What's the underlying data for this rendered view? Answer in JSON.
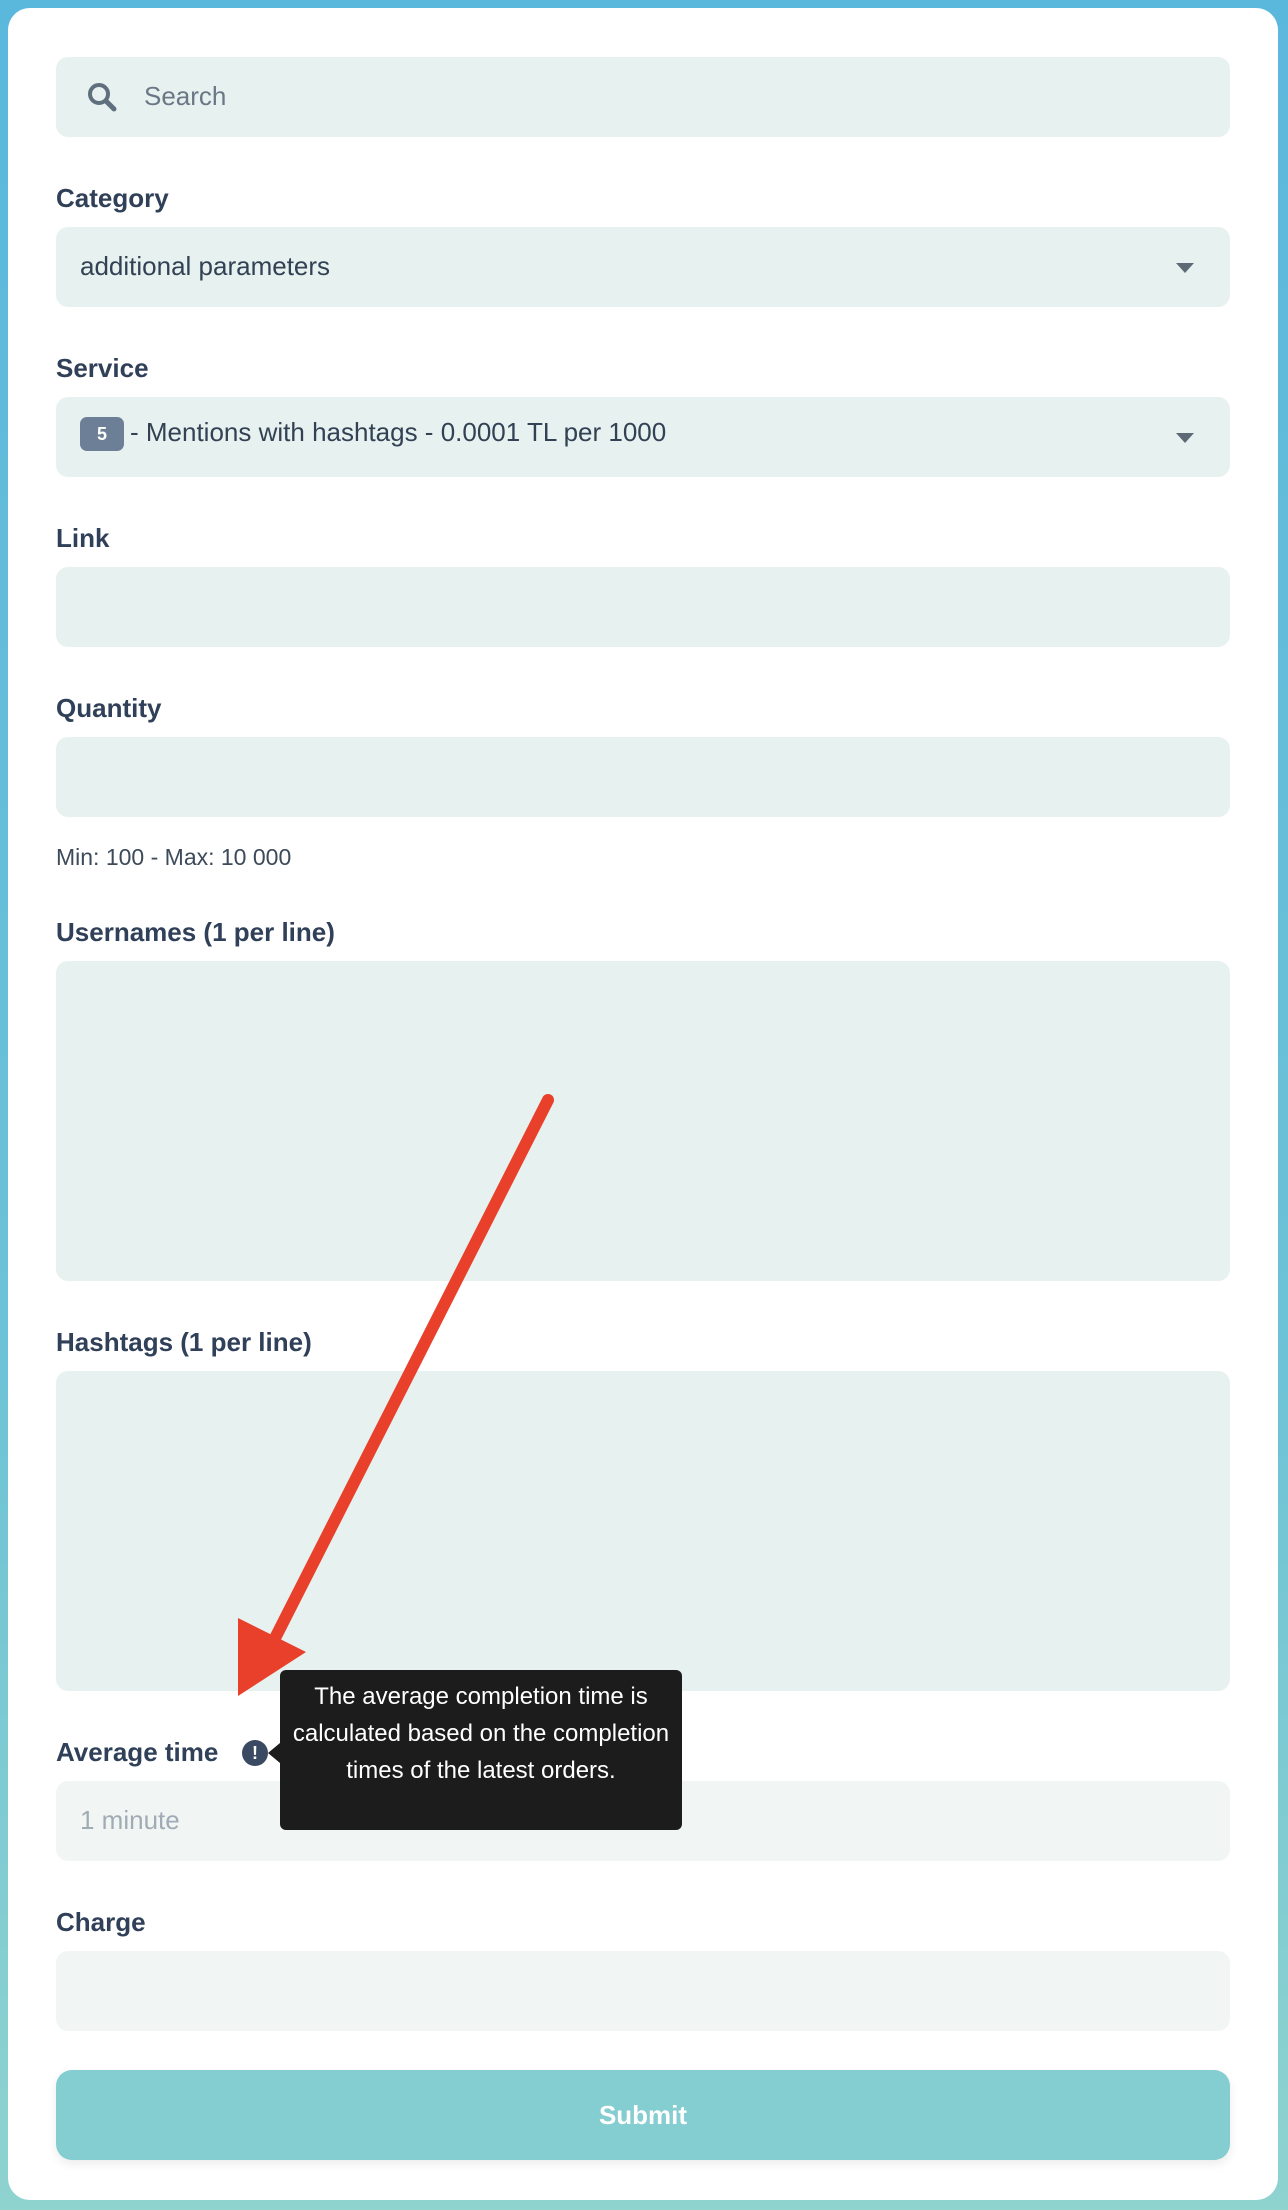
{
  "search": {
    "placeholder": "Search"
  },
  "category": {
    "label": "Category",
    "value": "additional parameters"
  },
  "service": {
    "label": "Service",
    "badge": "5",
    "value": "- Mentions with hashtags - 0.0001 TL per 1000"
  },
  "link": {
    "label": "Link",
    "value": ""
  },
  "quantity": {
    "label": "Quantity",
    "value": "",
    "hint": "Min: 100 - Max: 10 000"
  },
  "usernames": {
    "label": "Usernames (1 per line)",
    "value": ""
  },
  "hashtags": {
    "label": "Hashtags (1 per line)",
    "value": ""
  },
  "average_time": {
    "label": "Average time",
    "info_icon": "!",
    "value": "1 minute",
    "tooltip": "The average completion time is calculated based on the completion times of the latest orders."
  },
  "charge": {
    "label": "Charge",
    "value": ""
  },
  "submit": {
    "label": "Submit"
  },
  "colors": {
    "background_top": "#5bb8dd",
    "field_bg": "#e7f1ef",
    "label": "#2f4058",
    "submit_bg": "#84cdd0",
    "annotation_arrow": "#e8402a",
    "tooltip_bg": "#1c1c1c"
  }
}
